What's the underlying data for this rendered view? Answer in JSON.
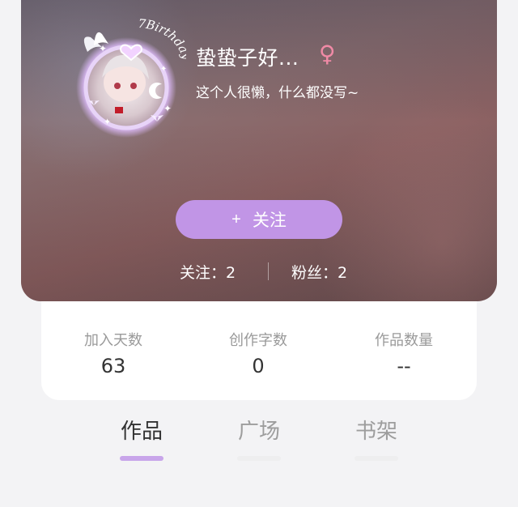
{
  "profile": {
    "avatar_text": "7Birthday",
    "username": "蛰蛰子好...",
    "gender_symbol": "♀",
    "bio": "这个人很懒，什么都没写~",
    "follow_plus": "+",
    "follow_label": "关注",
    "following_text": "关注：2",
    "fans_text": "粉丝：2"
  },
  "metrics": [
    {
      "label": "加入天数",
      "value": "63"
    },
    {
      "label": "创作字数",
      "value": "0"
    },
    {
      "label": "作品数量",
      "value": "--"
    }
  ],
  "tabs": [
    {
      "label": "作品",
      "active": true
    },
    {
      "label": "广场",
      "active": false
    },
    {
      "label": "书架",
      "active": false
    }
  ],
  "colors": {
    "accent": "#c195e6",
    "tab_indicator": "#c8a5ea",
    "gender": "#f08aa6"
  }
}
